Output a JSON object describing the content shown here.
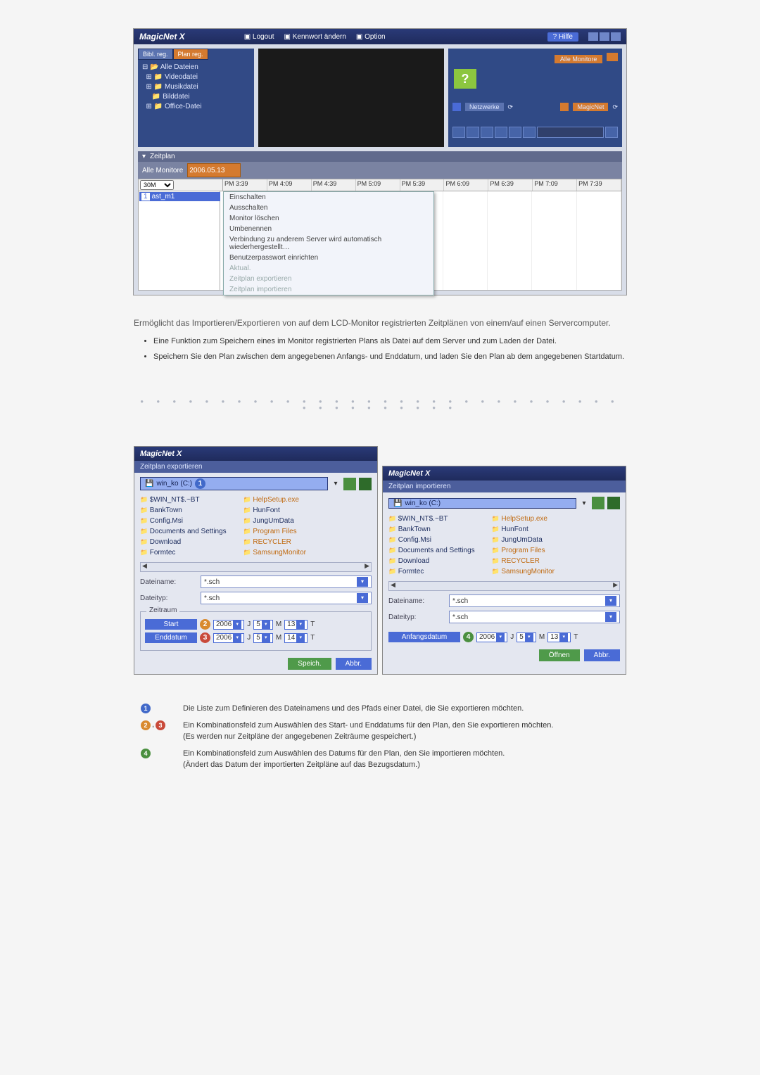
{
  "app1": {
    "logo": "MagicNet X",
    "menu_logout": "Logout",
    "menu_pass": "Kennwort ändern",
    "menu_option": "Option",
    "menu_help": "Hilfe",
    "tree_tab1": "Bibl. reg.",
    "tree_tab2": "Plan reg.",
    "tree_root": "Alle Dateien",
    "tree_video": "Videodatei",
    "tree_music": "Musikdatei",
    "tree_image": "Bilddatei",
    "tree_office": "Office-Datei",
    "mon_all": "Alle Monitore",
    "mon_net": "Netzwerke",
    "mon_magic": "MagicNet",
    "sched_label": "Zeitplan",
    "sched_all": "Alle Monitore",
    "sched_date": "2006.05.13",
    "sched_interval": "30M",
    "row_name": "ast_m1",
    "timeline_col0": "ast_m1",
    "ticks": [
      "PM 3:39",
      "PM 4:09",
      "PM 4:39",
      "PM 5:09",
      "PM 5:39",
      "PM 6:09",
      "PM 6:39",
      "PM 7:09",
      "PM 7:39"
    ],
    "ctx": {
      "on": "Einschalten",
      "off": "Ausschalten",
      "del": "Monitor löschen",
      "ren": "Umbenennen",
      "reconnect": "Verbindung zu anderem Server wird automatisch wiederhergestellt…",
      "pwd": "Benutzerpasswort einrichten",
      "aktual": "Aktual.",
      "export": "Zeitplan exportieren",
      "import": "Zeitplan importieren"
    }
  },
  "desc": {
    "intro": "Ermöglicht das Importieren/Exportieren von auf dem LCD-Monitor registrierten Zeitplänen von einem/auf einen Servercomputer.",
    "li1": "Eine Funktion zum Speichern eines im Monitor registrierten Plans als Datei auf dem Server und zum Laden der Datei.",
    "li2": "Speichern Sie den Plan zwischen dem angegebenen Anfangs- und Enddatum, und laden Sie den Plan ab dem angegebenen Startdatum."
  },
  "export": {
    "title": "MagicNet X",
    "subtitle": "Zeitplan exportieren",
    "drive": "win_ko (C:)",
    "files_left": [
      "$WIN_NT$.~BT",
      "BankTown",
      "Config.Msi",
      "Documents and Settings",
      "Download",
      "Formtec"
    ],
    "files_right": [
      "HelpSetup.exe",
      "HunFont",
      "JungUmData",
      "Program Files",
      "RECYCLER",
      "SamsungMonitor"
    ],
    "lbl_filename": "Dateiname:",
    "lbl_filetype": "Dateityp:",
    "val_filename": "*.sch",
    "val_filetype": "*.sch",
    "zeitraum": "Zeitraum",
    "start": "Start",
    "end": "Enddatum",
    "year": "2006",
    "y_suffix": "J",
    "m": "5",
    "m_suffix": "M",
    "d_start": "13",
    "d_end": "14",
    "d_suffix": "T",
    "btn_save": "Speich.",
    "btn_cancel": "Abbr."
  },
  "import": {
    "title": "MagicNet X",
    "subtitle": "Zeitplan importieren",
    "drive": "win_ko (C:)",
    "files_left": [
      "$WIN_NT$.~BT",
      "BankTown",
      "Config.Msi",
      "Documents and Settings",
      "Download",
      "Formtec"
    ],
    "files_right": [
      "HelpSetup.exe",
      "HunFont",
      "JungUmData",
      "Program Files",
      "RECYCLER",
      "SamsungMonitor"
    ],
    "lbl_filename": "Dateiname:",
    "lbl_filetype": "Dateityp:",
    "val_filename": "*.sch",
    "val_filetype": "*.sch",
    "start": "Anfangsdatum",
    "year": "2006",
    "y_suffix": "J",
    "m": "5",
    "m_suffix": "M",
    "d": "13",
    "d_suffix": "T",
    "btn_open": "Öffnen",
    "btn_cancel": "Abbr."
  },
  "legend": {
    "l1": "Die Liste zum Definieren des Dateinamens und des Pfads einer Datei, die Sie exportieren möchten.",
    "l2a": "Ein Kombinationsfeld zum Auswählen des Start- und Enddatums für den Plan, den Sie exportieren möchten.",
    "l2b": "(Es werden nur Zeitpläne der angegebenen Zeiträume gespeichert.)",
    "l3a": "Ein Kombinationsfeld zum Auswählen des Datums für den Plan, den Sie importieren möchten.",
    "l3b": "(Ändert das Datum der importierten Zeitpläne auf das Bezugsdatum.)"
  }
}
